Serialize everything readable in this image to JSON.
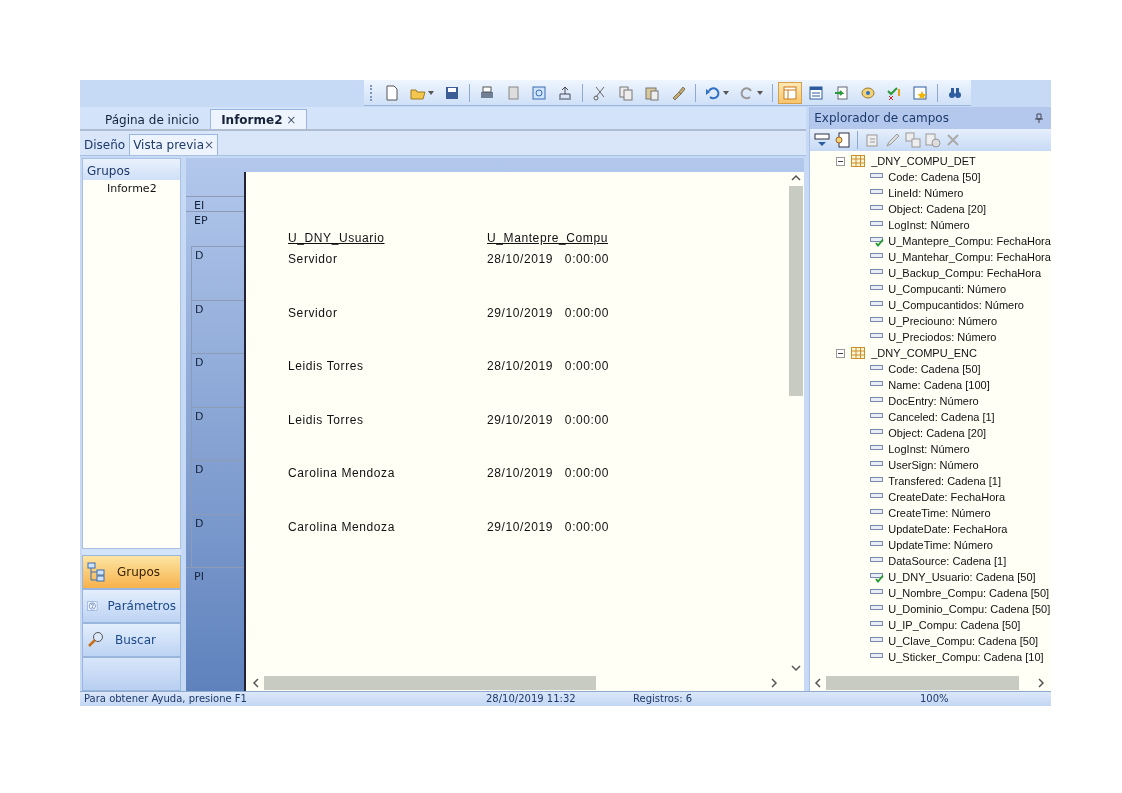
{
  "toolbar": {
    "buttons": [
      {
        "selected": false
      },
      {
        "selected": false
      },
      {
        "selected": false
      },
      {
        "selected": false
      },
      {
        "selected": false
      },
      {
        "selected": false
      },
      {
        "selected": false
      },
      {
        "selected": false
      },
      {
        "selected": false
      },
      {
        "selected": false
      },
      {
        "selected": false
      },
      {
        "selected": false
      },
      {
        "selected": false
      },
      {
        "selected": true
      },
      {
        "selected": false
      },
      {
        "selected": false
      },
      {
        "selected": false
      },
      {
        "selected": false
      },
      {
        "selected": false
      },
      {
        "selected": false
      }
    ]
  },
  "tabs": [
    {
      "label": "Página de inicio",
      "selected": false
    },
    {
      "label": "Informe2",
      "selected": true,
      "close_glyph": "×"
    }
  ],
  "view_tabs": [
    {
      "label": "Diseño",
      "selected": false
    },
    {
      "label": "Vista previa",
      "selected": true,
      "close_glyph": "×"
    }
  ],
  "groups_panel": {
    "title": "Grupos",
    "items": [
      "Informe2"
    ]
  },
  "nav_buttons": [
    {
      "kind": "groups",
      "label": "Grupos",
      "selected": true
    },
    {
      "kind": "parameters",
      "label": "Parámetros",
      "selected": false
    },
    {
      "kind": "search",
      "label": "Buscar",
      "selected": false
    }
  ],
  "report": {
    "bands": [
      {
        "kind": "header",
        "label": "EI"
      },
      {
        "kind": "page_header",
        "label": "EP"
      },
      {
        "kind": "detail",
        "label": "D"
      },
      {
        "kind": "detail",
        "label": "D"
      },
      {
        "kind": "detail",
        "label": "D"
      },
      {
        "kind": "detail",
        "label": "D"
      },
      {
        "kind": "detail",
        "label": "D"
      },
      {
        "kind": "detail",
        "label": "D"
      },
      {
        "kind": "page_footer",
        "label": "PI"
      }
    ],
    "columns": [
      "U_DNY_Usuario",
      "U_Mantepre_Compu"
    ],
    "rows": [
      {
        "usuario": "Servidor",
        "fecha": "28/10/2019   0:00:00"
      },
      {
        "usuario": "Servidor",
        "fecha": "29/10/2019   0:00:00"
      },
      {
        "usuario": "Leidis Torres",
        "fecha": "28/10/2019   0:00:00"
      },
      {
        "usuario": "Leidis Torres",
        "fecha": "29/10/2019   0:00:00"
      },
      {
        "usuario": "Carolina Mendoza",
        "fecha": "28/10/2019   0:00:00"
      },
      {
        "usuario": "Carolina Mendoza",
        "fecha": "29/10/2019   0:00:00"
      }
    ]
  },
  "field_explorer": {
    "title": "Explorador de campos",
    "tree": [
      {
        "name": "_DNY_COMPU_DET",
        "expanded": true,
        "children": [
          {
            "name": "Code: Cadena [50]",
            "checked": false
          },
          {
            "name": "LineId: Número",
            "checked": false
          },
          {
            "name": "Object: Cadena [20]",
            "checked": false
          },
          {
            "name": "LogInst: Número",
            "checked": false
          },
          {
            "name": "U_Mantepre_Compu: FechaHora",
            "checked": true
          },
          {
            "name": "U_Mantehar_Compu: FechaHora",
            "checked": false
          },
          {
            "name": "U_Backup_Compu: FechaHora",
            "checked": false
          },
          {
            "name": "U_Compucanti: Número",
            "checked": false
          },
          {
            "name": "U_Compucantidos: Número",
            "checked": false
          },
          {
            "name": "U_Preciouno: Número",
            "checked": false
          },
          {
            "name": "U_Preciodos: Número",
            "checked": false
          }
        ]
      },
      {
        "name": "_DNY_COMPU_ENC",
        "expanded": true,
        "children": [
          {
            "name": "Code: Cadena [50]",
            "checked": false
          },
          {
            "name": "Name: Cadena [100]",
            "checked": false
          },
          {
            "name": "DocEntry: Número",
            "checked": false
          },
          {
            "name": "Canceled: Cadena [1]",
            "checked": false
          },
          {
            "name": "Object: Cadena [20]",
            "checked": false
          },
          {
            "name": "LogInst: Número",
            "checked": false
          },
          {
            "name": "UserSign: Número",
            "checked": false
          },
          {
            "name": "Transfered: Cadena [1]",
            "checked": false
          },
          {
            "name": "CreateDate: FechaHora",
            "checked": false
          },
          {
            "name": "CreateTime: Número",
            "checked": false
          },
          {
            "name": "UpdateDate: FechaHora",
            "checked": false
          },
          {
            "name": "UpdateTime: Número",
            "checked": false
          },
          {
            "name": "DataSource: Cadena [1]",
            "checked": false
          },
          {
            "name": "U_DNY_Usuario: Cadena [50]",
            "checked": true
          },
          {
            "name": "U_Nombre_Compu: Cadena [50]",
            "checked": false
          },
          {
            "name": "U_Dominio_Compu: Cadena [50]",
            "checked": false
          },
          {
            "name": "U_IP_Compu: Cadena [50]",
            "checked": false
          },
          {
            "name": "U_Clave_Compu: Cadena [50]",
            "checked": false
          },
          {
            "name": "U_Sticker_Compu: Cadena [10]",
            "checked": false
          }
        ]
      }
    ]
  },
  "status_bar": {
    "help": "Para obtener Ayuda, presione F1",
    "datetime": "28/10/2019  11:32",
    "records": "Registros:  6",
    "zoom": "100%"
  }
}
